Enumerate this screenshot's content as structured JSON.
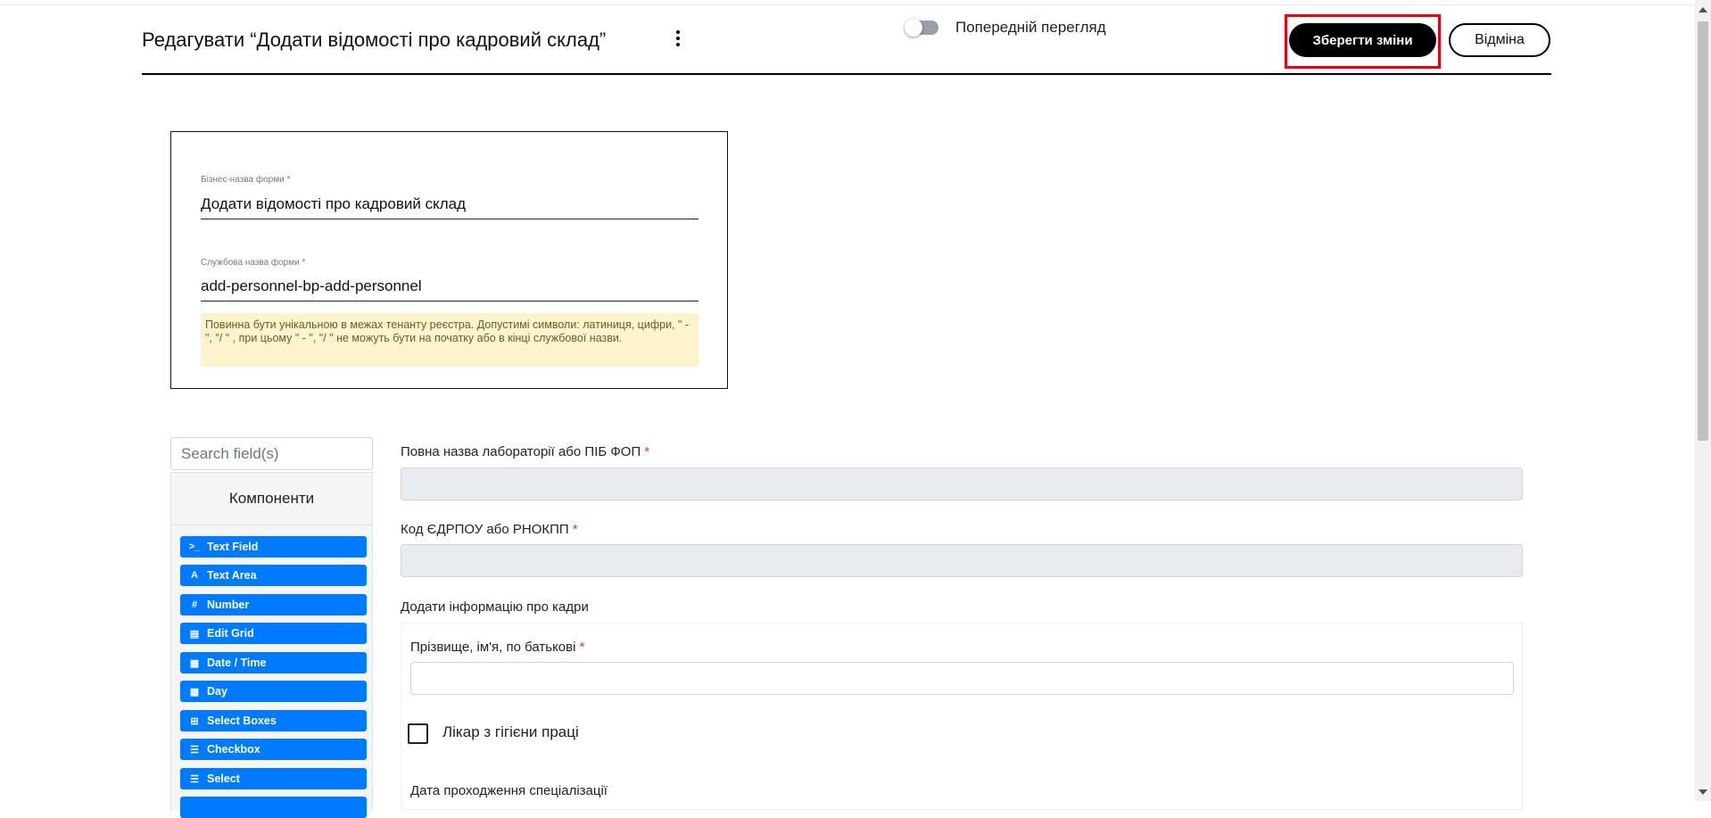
{
  "header": {
    "title": "Редагувати “Додати відомості про кадровий склад”",
    "preview_label": "Попередній перегляд",
    "save_label": "Зберегти зміни",
    "cancel_label": "Відміна"
  },
  "form_card": {
    "business_name_label": "Бізнес-назва форми *",
    "business_name_value": "Додати відомості про кадровий склад",
    "service_name_label": "Службова назва форми *",
    "service_name_value": "add-personnel-bp-add-personnel",
    "hint": "Повинна бути унікальною в межах тенанту реєстра. Допустимі символи: латиниця, цифри, \" - \", \"/ \" , при цьому  \" - \", \"/ \" не можуть бути на початку або в кінці службової назви."
  },
  "sidebar": {
    "search_placeholder": "Search field(s)",
    "components_title": "Компоненти",
    "components": [
      {
        "label": "Text Field",
        "icon": "terminal-icon",
        "glyph": ">_"
      },
      {
        "label": "Text Area",
        "icon": "font-icon",
        "glyph": "A"
      },
      {
        "label": "Number",
        "icon": "hashtag-icon",
        "glyph": "#"
      },
      {
        "label": "Edit Grid",
        "icon": "tasks-icon",
        "glyph": "▤"
      },
      {
        "label": "Date / Time",
        "icon": "calendar-icon",
        "glyph": "▦"
      },
      {
        "label": "Day",
        "icon": "calendar-icon",
        "glyph": "▦"
      },
      {
        "label": "Select Boxes",
        "icon": "plus-square-icon",
        "glyph": "⊞"
      },
      {
        "label": "Checkbox",
        "icon": "th-list-icon",
        "glyph": "☰"
      },
      {
        "label": "Select",
        "icon": "th-list-icon",
        "glyph": "☰"
      }
    ]
  },
  "main": {
    "field1_label": "Повна назва лабораторії або ПІБ ФОП",
    "field2_label": "Код ЄДРПОУ або РНОКПП",
    "section_label": "Додати інформацію про кадри",
    "field3_label": "Прізвище, ім'я, по батькові",
    "checkbox_label": "Лікар з гігієни праці",
    "field4_label": "Дата проходження спеціалізації",
    "required_mark": "*"
  },
  "colors": {
    "accent": "#007bff",
    "highlight": "#e8000b",
    "hint_bg": "#fff3cd",
    "disabled_input": "#e9ecef"
  }
}
